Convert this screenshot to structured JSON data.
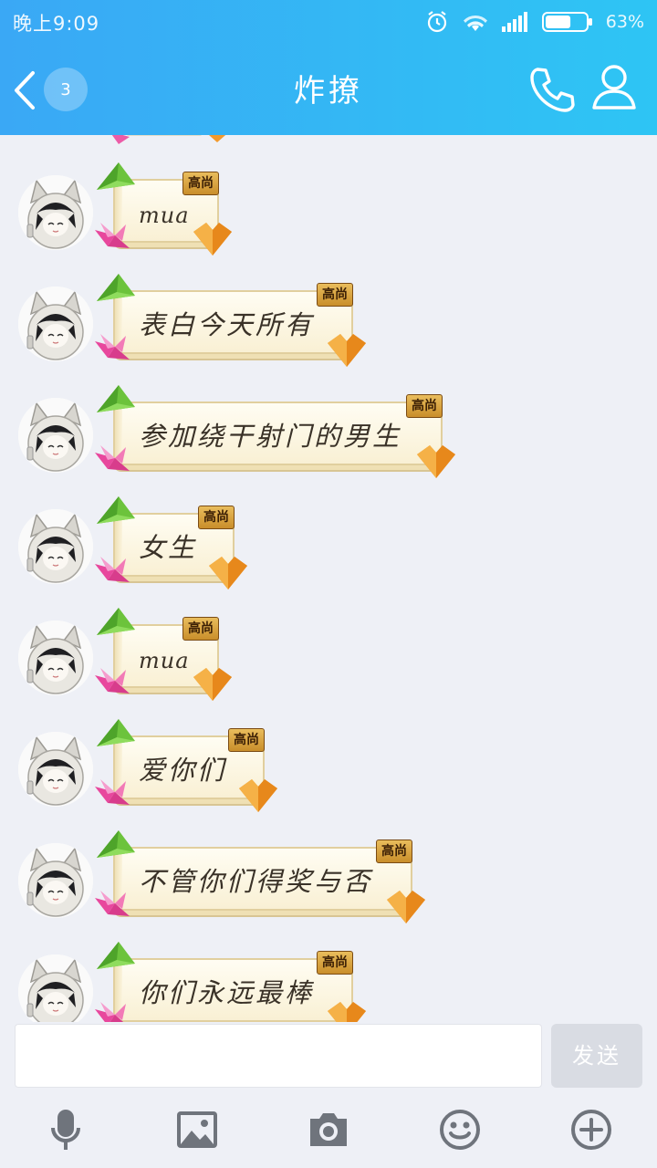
{
  "status_bar": {
    "time": "晚上9:09",
    "battery_percent": "63%",
    "battery_level": 0.63,
    "icons": [
      "alarm-icon",
      "wifi-icon",
      "signal-icon",
      "battery-icon"
    ]
  },
  "header": {
    "back_badge": "3",
    "title": "炸撩",
    "call_icon": "phone-icon",
    "profile_icon": "person-icon",
    "colors": {
      "gradient_start": "#3aa8f5",
      "gradient_end": "#2ec5f4"
    }
  },
  "messages": [
    {
      "text": "mua",
      "badge": "高尚"
    },
    {
      "text": "表白今天所有",
      "badge": "高尚"
    },
    {
      "text": "参加绕干射门的男生",
      "badge": "高尚"
    },
    {
      "text": "女生",
      "badge": "高尚"
    },
    {
      "text": "mua",
      "badge": "高尚"
    },
    {
      "text": "爱你们",
      "badge": "高尚"
    },
    {
      "text": "不管你们得奖与否",
      "badge": "高尚"
    },
    {
      "text": "你们永远最棒",
      "badge": "高尚"
    }
  ],
  "input": {
    "value": "",
    "placeholder": "",
    "send_label": "发送"
  },
  "toolbar": {
    "items": [
      "microphone-icon",
      "image-icon",
      "camera-icon",
      "emoji-icon",
      "plus-icon"
    ]
  }
}
